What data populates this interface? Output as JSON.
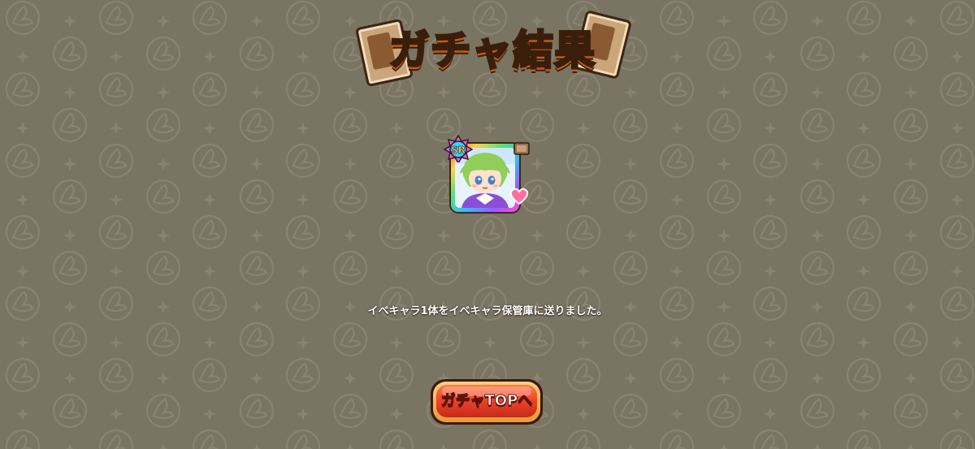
{
  "screen": {
    "title": "ガチャ結果",
    "background_color": "#7a7462",
    "pattern_color": "#8a8470"
  },
  "result": {
    "card_rarity": "SR",
    "message": "イベキャラ1体をイベキャラ保管庫に送りました。"
  },
  "actions": {
    "gacha_top_label": "ガチャTOPへ"
  },
  "icons": {
    "rarity_badge": "sr-rarity-badge-icon",
    "event_tag": "event-tag-icon",
    "heart": "heart-icon"
  },
  "colors": {
    "title_fill": "#ffd83a",
    "title_outline": "#3a1e0c",
    "button_face": "#e8402a",
    "button_rim": "#ffc45a",
    "message_text": "#ffffff"
  }
}
